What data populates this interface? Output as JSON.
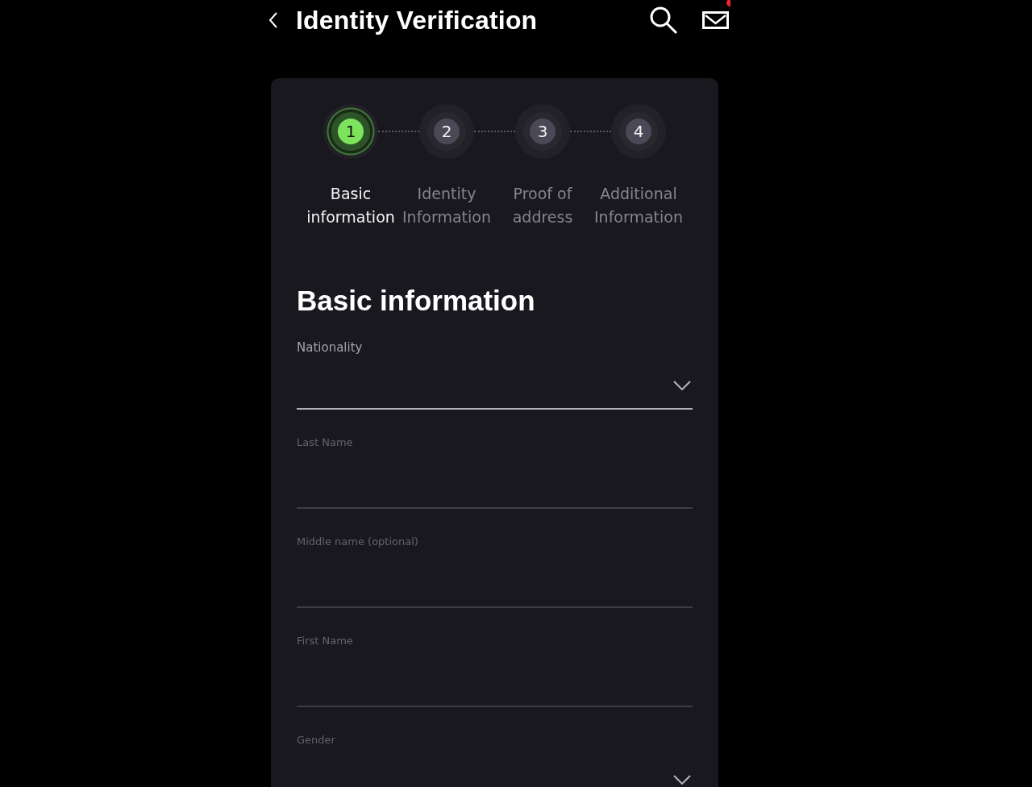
{
  "header": {
    "title": "Identity Verification",
    "unread": true
  },
  "steps": [
    {
      "number": "1",
      "label": "Basic information",
      "selected": true
    },
    {
      "number": "2",
      "label": "Identity Information",
      "selected": false
    },
    {
      "number": "3",
      "label": "Proof of address",
      "selected": false
    },
    {
      "number": "4",
      "label": "Additional Information",
      "selected": false
    }
  ],
  "form": {
    "heading": "Basic information",
    "fields": [
      {
        "label": "Nationality",
        "kind": "select",
        "focused": true
      },
      {
        "label": "Last Name",
        "kind": "text",
        "focused": false
      },
      {
        "label": "Middle name (optional)",
        "kind": "text",
        "focused": false
      },
      {
        "label": "First Name",
        "kind": "text",
        "focused": false
      },
      {
        "label": "Gender",
        "kind": "select",
        "focused": false
      }
    ]
  }
}
